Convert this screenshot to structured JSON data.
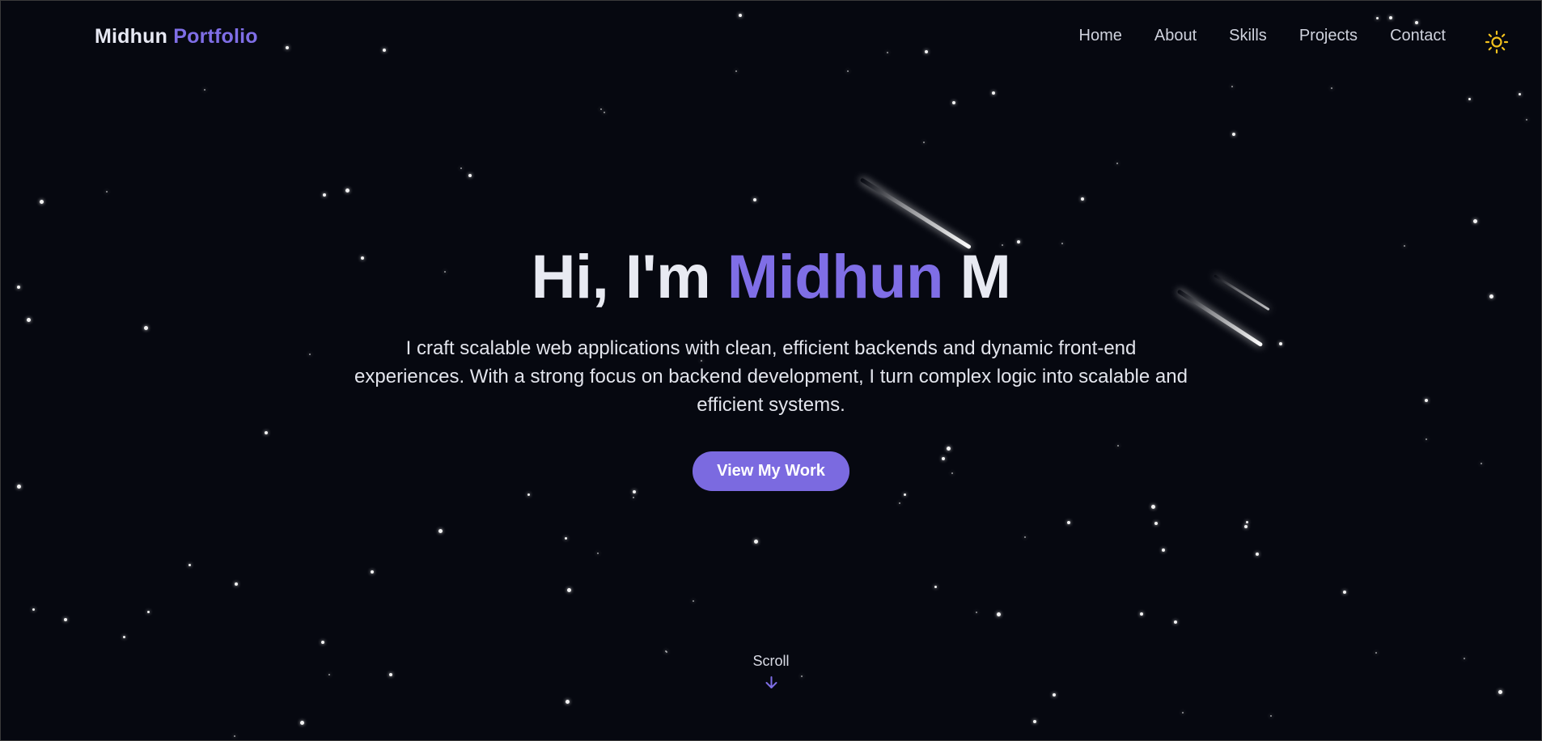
{
  "brand": {
    "first": "Midhun",
    "second": "Portfolio"
  },
  "nav": {
    "links": [
      "Home",
      "About",
      "Skills",
      "Projects",
      "Contact"
    ],
    "theme_toggle_icon": "sun-icon"
  },
  "hero": {
    "title_prefix": "Hi, I'm",
    "title_name": "Midhun",
    "title_suffix": "M",
    "description": "I craft scalable web applications with clean, efficient backends and dynamic front-end experiences. With a strong focus on backend development, I turn complex logic into scalable and efficient systems.",
    "cta_label": "View My Work"
  },
  "scroll": {
    "label": "Scroll",
    "icon": "arrow-down-icon"
  },
  "colors": {
    "background": "#060810",
    "accent": "#7f6ee6",
    "button": "#7b6ae0",
    "sun": "#f4c21d"
  }
}
